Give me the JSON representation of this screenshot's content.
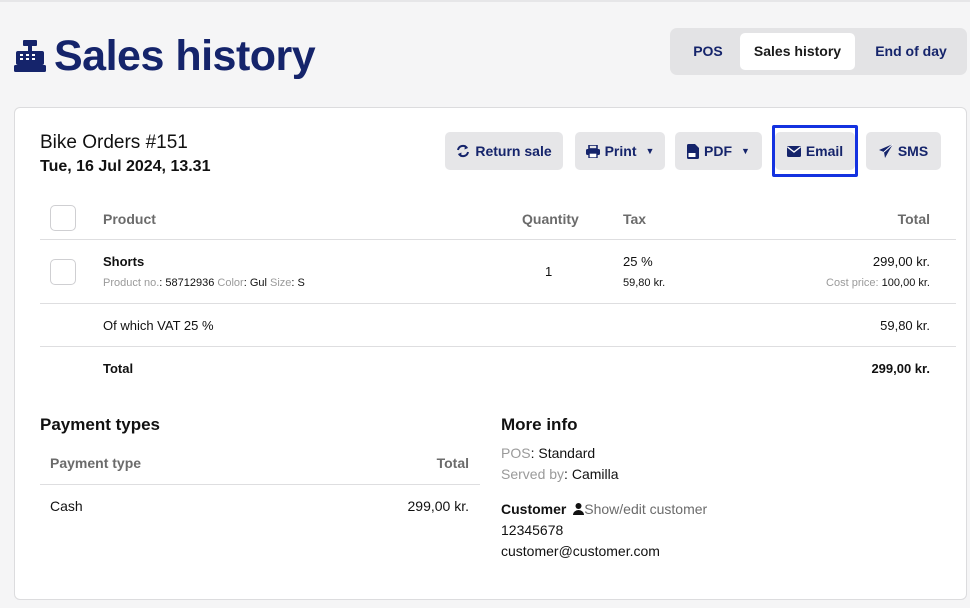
{
  "header": {
    "title": "Sales history",
    "icon": "cash-register-icon",
    "accent_color": "#15246b"
  },
  "nav": {
    "tabs": [
      {
        "label": "POS",
        "active": false
      },
      {
        "label": "Sales history",
        "active": true
      },
      {
        "label": "End of day",
        "active": false
      }
    ]
  },
  "order": {
    "title": "Bike Orders #151",
    "date": "Tue, 16 Jul 2024, 13.31"
  },
  "actions": {
    "return_sale": "Return sale",
    "print": "Print",
    "pdf": "PDF",
    "email": "Email",
    "sms": "SMS",
    "highlight_color": "#1432e0"
  },
  "table": {
    "columns": {
      "product": "Product",
      "quantity": "Quantity",
      "tax": "Tax",
      "total": "Total"
    },
    "rows": [
      {
        "name": "Shorts",
        "product_no_label": "Product no.",
        "product_no": "58712936",
        "color_label": "Color",
        "color": "Gul",
        "size_label": "Size",
        "size": "S",
        "quantity": "1",
        "tax_rate": "25 %",
        "tax_amount": "59,80 kr.",
        "total": "299,00 kr.",
        "cost_price_label": "Cost price:",
        "cost_price": "100,00 kr."
      }
    ],
    "vat_label": "Of which VAT 25 %",
    "vat_amount": "59,80 kr.",
    "total_label": "Total",
    "total_amount": "299,00 kr."
  },
  "payment": {
    "title": "Payment types",
    "col_type": "Payment type",
    "col_total": "Total",
    "rows": [
      {
        "type": "Cash",
        "total": "299,00 kr."
      }
    ]
  },
  "info": {
    "title": "More info",
    "pos_label": "POS",
    "pos_value": "Standard",
    "served_label": "Served by",
    "served_value": "Camilla",
    "customer_label": "Customer",
    "customer_link": "Show/edit customer",
    "phone": "12345678",
    "email": "customer@customer.com"
  }
}
